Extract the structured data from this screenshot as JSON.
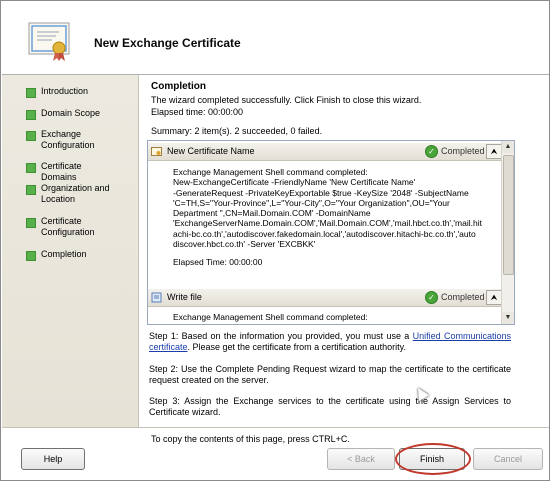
{
  "window": {
    "title": "New Exchange Certificate"
  },
  "sidebar": {
    "items": [
      {
        "label": "Introduction"
      },
      {
        "label": "Domain Scope"
      },
      {
        "label": "Exchange Configuration"
      },
      {
        "label": "Certificate Domains"
      },
      {
        "label": "Organization and Location"
      },
      {
        "label": "Certificate Configuration"
      },
      {
        "label": "Completion"
      }
    ]
  },
  "completion": {
    "heading": "Completion",
    "message": "The wizard completed successfully. Click Finish to close this wizard.",
    "elapsed": "Elapsed time: 00:00:00",
    "summary": "Summary: 2 item(s). 2 succeeded, 0 failed."
  },
  "results": [
    {
      "name": "New Certificate Name",
      "status": "Completed",
      "lines": [
        "Exchange Management Shell command completed:",
        "New-ExchangeCertificate -FriendlyName 'New Certificate Name'",
        "-GenerateRequest -PrivateKeyExportable $true -KeySize '2048' -SubjectName",
        "'C=TH,S=\"Your-Province\",L=\"Your-City\",O=\"Your Organization\",OU=\"Your",
        "Department \",CN=Mail.Domain.COM' -DomainName",
        "'ExchangeServerName.Domain.COM','Mail.Domain.COM','mail.hbct.co.th','mail.hit",
        "achi-bc.co.th','autodiscover.fakedomain.local','autodiscover.hitachi-bc.co.th','auto",
        "discover.hbct.co.th' -Server 'EXCBKK'"
      ],
      "elapsed": "Elapsed Time: 00:00:00"
    },
    {
      "name": "Write file",
      "status": "Completed",
      "lines": [
        "Exchange Management Shell command completed:"
      ]
    }
  ],
  "steps": {
    "step1_before": "Step 1: Based on the information you provided, you must use a ",
    "step1_link": "Unified Communications certificate",
    "step1_after": ". Please get the certificate from a certification authority.",
    "step2": "Step 2: Use the Complete Pending Request wizard to map the certificate to the certificate request created on the server.",
    "step3": "Step 3: Assign the Exchange services to the certificate using the Assign Services to Certificate wizard."
  },
  "copy_hint": "To copy the contents of this page, press CTRL+C.",
  "buttons": {
    "help": "Help",
    "back": "< Back",
    "finish": "Finish",
    "cancel": "Cancel"
  },
  "icons": {
    "certificate": "certificate-icon",
    "success": "check-icon",
    "collapse": "double-chevron-up-icon"
  },
  "colors": {
    "nav_done": "#58b04a",
    "link": "#1a3fa8",
    "highlight_ring": "#c0392b"
  }
}
